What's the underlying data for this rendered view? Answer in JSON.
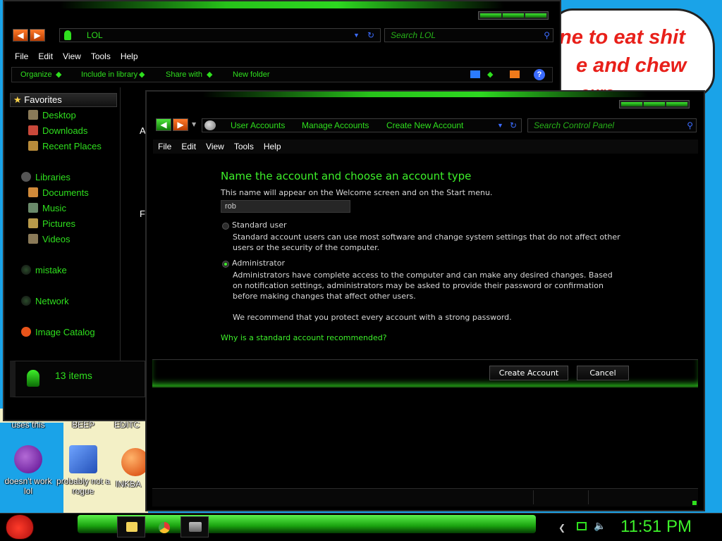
{
  "wallpaper": {
    "sign_line1": "ne to eat shit",
    "sign_line2": "e and chew",
    "sign_line3": "ours"
  },
  "desktop": {
    "labels_top": [
      "uses this",
      "BEEP",
      "EDITC"
    ],
    "icons": [
      {
        "label": "doesn't work lol",
        "icon": "yahoo-messenger-icon"
      },
      {
        "label": "probably not a rogue",
        "icon": "gears-icon"
      },
      {
        "label": "INKBA",
        "icon": "orange-ball-icon"
      }
    ]
  },
  "explorer": {
    "address": "LOL",
    "search_placeholder": "Search LOL",
    "menu": [
      "File",
      "Edit",
      "View",
      "Tools",
      "Help"
    ],
    "commands": [
      "Organize",
      "Include in library",
      "Share with",
      "New folder"
    ],
    "nav": {
      "favorites": "Favorites",
      "fav_items": [
        "Desktop",
        "Downloads",
        "Recent Places"
      ],
      "libraries": "Libraries",
      "lib_items": [
        "Documents",
        "Music",
        "Pictures",
        "Videos"
      ],
      "mistake": "mistake",
      "network": "Network",
      "catalog": "Image Catalog"
    },
    "partial_letters": [
      "A",
      "F"
    ],
    "status": "13 items"
  },
  "control_panel": {
    "breadcrumb": [
      "User Accounts",
      "Manage Accounts",
      "Create New Account"
    ],
    "search_placeholder": "Search Control Panel",
    "menu": [
      "File",
      "Edit",
      "View",
      "Tools",
      "Help"
    ],
    "heading": "Name the account and choose an account type",
    "subtitle": "This name will appear on the Welcome screen and on the Start menu.",
    "name_value": "rob",
    "standard_label": "Standard user",
    "standard_desc": "Standard account users can use most software and change system settings that do not affect other users or the security of the computer.",
    "admin_label": "Administrator",
    "admin_desc": "Administrators have complete access to the computer and can make any desired changes. Based on notification settings, administrators may be asked to provide their password or confirmation before making changes that affect other users.",
    "recommend": "We recommend that you protect every account with a strong password.",
    "link": "Why is a standard account recommended?",
    "create_button": "Create Account",
    "cancel_button": "Cancel"
  },
  "taskbar": {
    "clock": "11:51 PM"
  },
  "colors": {
    "accent_green": "#3df02a",
    "wallpaper_blue": "#1aa3e8",
    "window_bg": "#000000"
  }
}
